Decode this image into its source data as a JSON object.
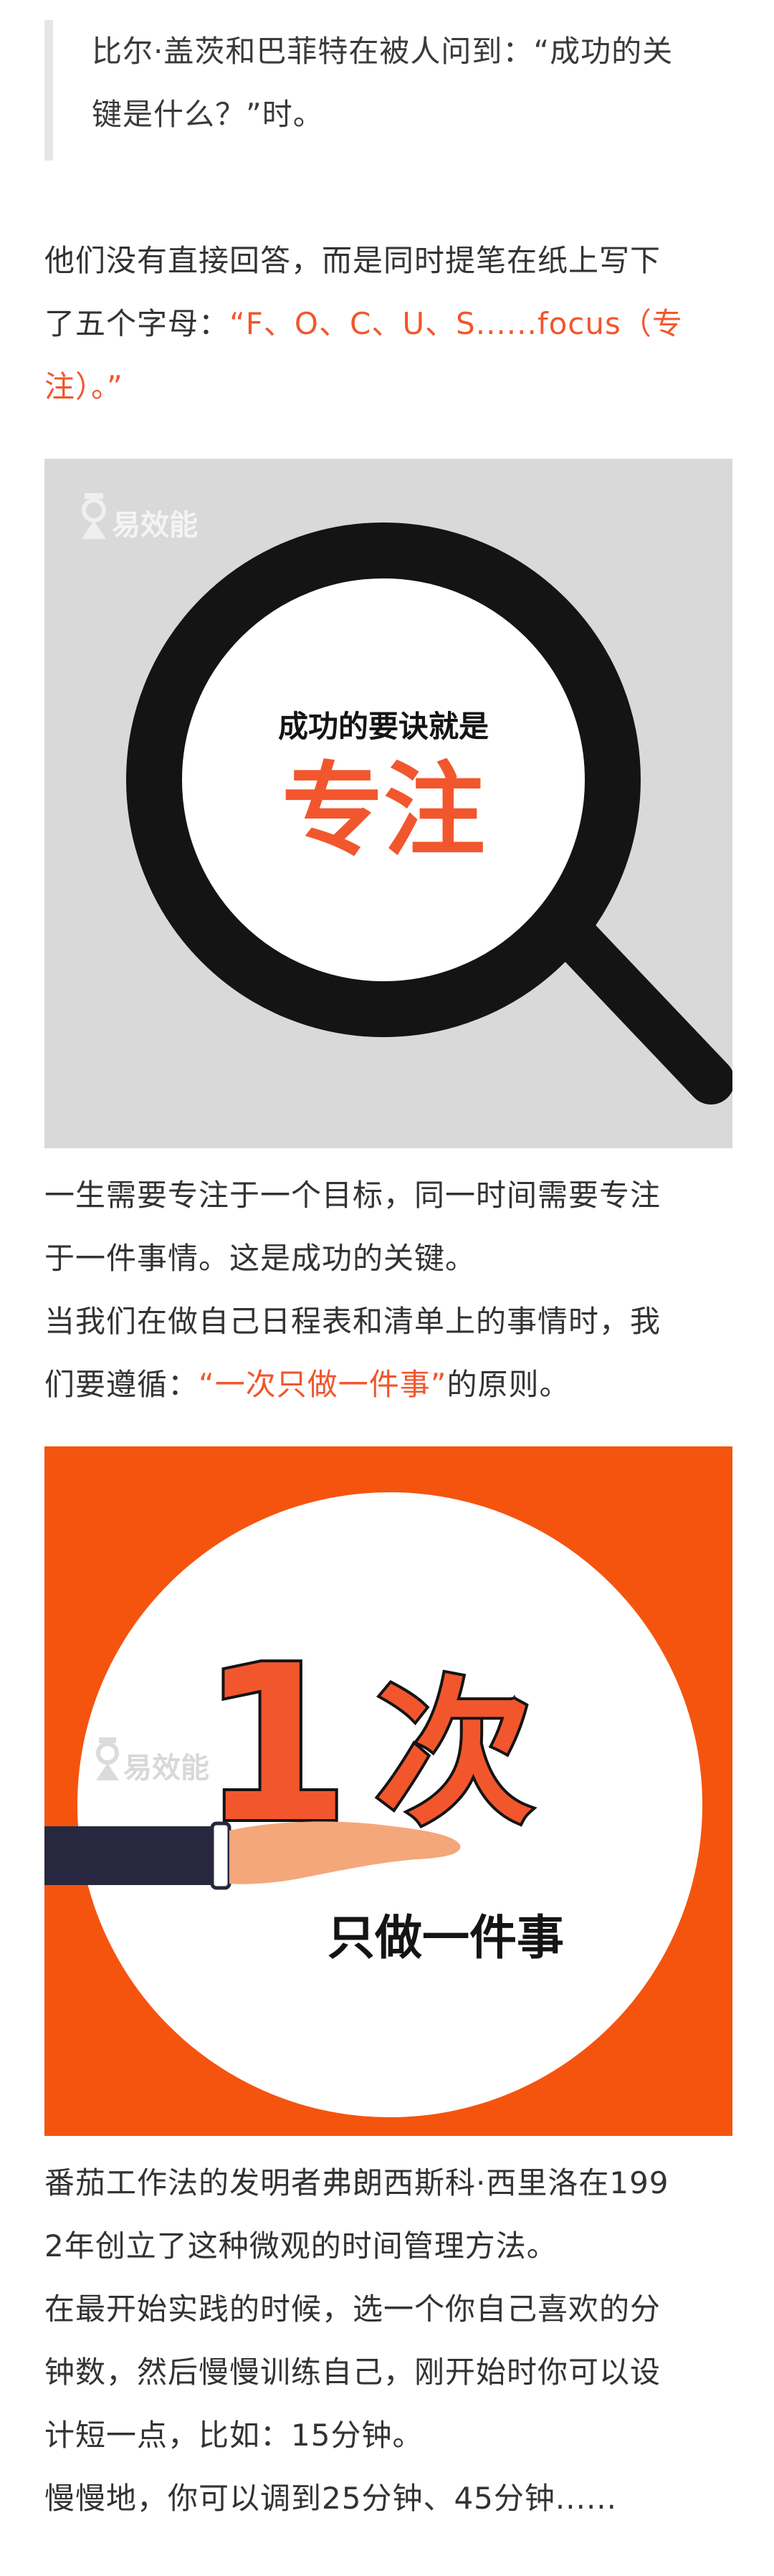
{
  "quote": {
    "line1": "比尔·盖茨和巴菲特在被人问到：“成功的关",
    "line2": "键是什么？”时。"
  },
  "para1": {
    "line1": "他们没有直接回答，而是同时提笔在纸上写下",
    "line2_plain": "了五个字母：",
    "line2_accent": "“F、O、C、U、S......focus（专",
    "line3_accent": "注）。”"
  },
  "image1": {
    "watermark": "易效能",
    "subtitle": "成功的要诀就是",
    "title": "专注",
    "colors": {
      "background": "#d9d9d9",
      "ring": "#141414",
      "accent": "#f2562d"
    }
  },
  "para2": {
    "line1": "一生需要专注于一个目标，同一时间需要专注",
    "line2": "于一件事情。这是成功的关键。",
    "line3": "当我们在做自己日程表和清单上的事情时，我",
    "line4_plain_a": "们要遵循：",
    "line4_accent": "“一次只做一件事”",
    "line4_plain_b": "的原则。"
  },
  "image2": {
    "watermark": "易效能",
    "big_number": "1",
    "big_char": "次",
    "caption": "只做一件事",
    "colors": {
      "background": "#f5540f",
      "circle": "#ffffff",
      "accent": "#f2562d",
      "sleeve": "#27283f",
      "hand": "#f4a77a"
    }
  },
  "para3": {
    "line1": "番茄工作法的发明者弗朗西斯科·西里洛在199",
    "line2": "2年创立了这种微观的时间管理方法。",
    "line3": "在最开始实践的时候，选一个你自己喜欢的分",
    "line4": "钟数，然后慢慢训练自己，刚开始时你可以设",
    "line5": "计短一点，比如：15分钟。",
    "line6": "慢慢地，你可以调到25分钟、45分钟......"
  }
}
